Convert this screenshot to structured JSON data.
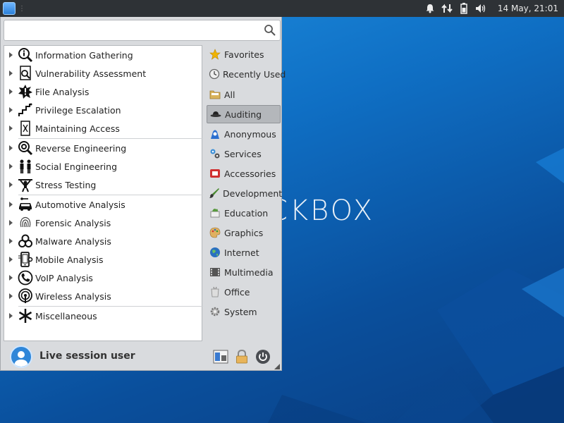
{
  "panel": {
    "clock": "14 May, 21:01",
    "tray_icons": [
      "bell-icon",
      "network-icon",
      "battery-icon",
      "volume-icon"
    ]
  },
  "wallpaper": {
    "text": "CKBOX"
  },
  "search": {
    "value": "",
    "placeholder": ""
  },
  "applications": [
    {
      "label": "Information Gathering",
      "icon": "info-magnifier-icon"
    },
    {
      "label": "Vulnerability Assessment",
      "icon": "document-search-icon"
    },
    {
      "label": "File Analysis",
      "icon": "file-alert-icon"
    },
    {
      "label": "Privilege Escalation",
      "icon": "stairs-icon"
    },
    {
      "label": "Maintaining Access",
      "icon": "door-icon"
    },
    {
      "label": "Reverse Engineering",
      "icon": "gear-magnifier-icon"
    },
    {
      "label": "Social Engineering",
      "icon": "people-icon"
    },
    {
      "label": "Stress Testing",
      "icon": "weight-lifter-icon"
    },
    {
      "label": "Automotive Analysis",
      "icon": "car-icon"
    },
    {
      "label": "Forensic Analysis",
      "icon": "fingerprint-icon"
    },
    {
      "label": "Malware Analysis",
      "icon": "biohazard-icon"
    },
    {
      "label": "Mobile Analysis",
      "icon": "mobile-icon"
    },
    {
      "label": "VoIP Analysis",
      "icon": "phone-icon"
    },
    {
      "label": "Wireless Analysis",
      "icon": "wireless-icon"
    },
    {
      "label": "Miscellaneous",
      "icon": "asterisk-icon"
    }
  ],
  "categories": [
    {
      "label": "Favorites",
      "icon": "star-icon",
      "color": "#f0b400"
    },
    {
      "label": "Recently Used",
      "icon": "clock-icon",
      "color": "#777777"
    },
    {
      "label": "All",
      "icon": "folder-icon",
      "color": "#c9a44a"
    },
    {
      "label": "Auditing",
      "icon": "hat-icon",
      "color": "#333333",
      "active": true
    },
    {
      "label": "Anonymous",
      "icon": "anonymous-icon",
      "color": "#2a6fd0"
    },
    {
      "label": "Services",
      "icon": "services-icon",
      "color": "#3a8fd8"
    },
    {
      "label": "Accessories",
      "icon": "accessories-icon",
      "color": "#d03030"
    },
    {
      "label": "Development",
      "icon": "brush-icon",
      "color": "#4a8a30"
    },
    {
      "label": "Education",
      "icon": "education-icon",
      "color": "#5a9a40"
    },
    {
      "label": "Graphics",
      "icon": "palette-icon",
      "color": "#c88a30"
    },
    {
      "label": "Internet",
      "icon": "globe-icon",
      "color": "#2a70c0"
    },
    {
      "label": "Multimedia",
      "icon": "multimedia-icon",
      "color": "#444444"
    },
    {
      "label": "Office",
      "icon": "office-icon",
      "color": "#999999"
    },
    {
      "label": "System",
      "icon": "system-gear-icon",
      "color": "#888888"
    }
  ],
  "user": {
    "name": "Live session user"
  },
  "bottom_buttons": [
    "switch-user-icon",
    "lock-icon",
    "power-icon"
  ],
  "colors": {
    "panel": "#2e3236",
    "menu_bg": "#d9dbde",
    "active_category": "#b4b7bb"
  }
}
